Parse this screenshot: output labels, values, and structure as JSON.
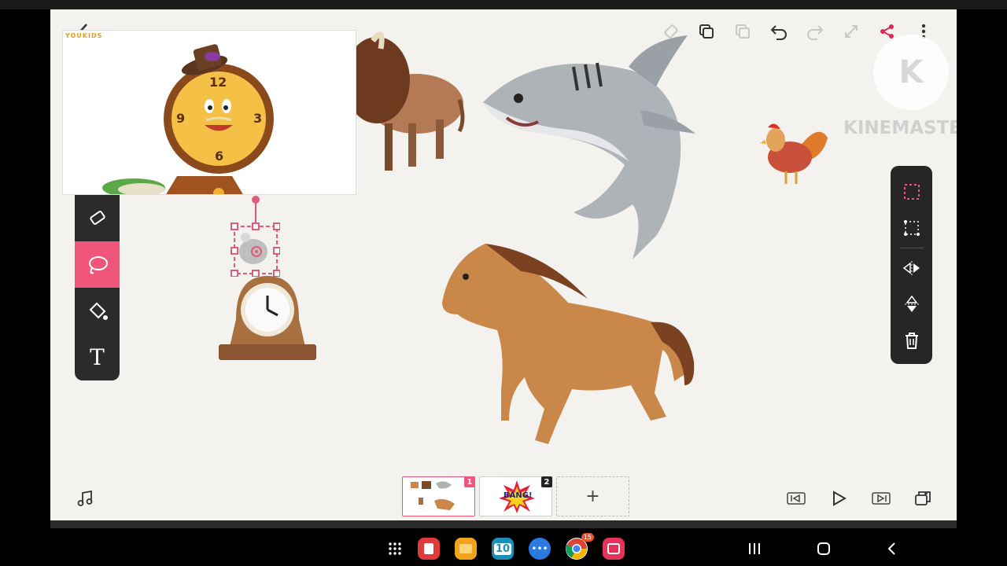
{
  "app": {
    "name": "drawing-canvas-app"
  },
  "top_bar": {
    "back_icon": "chevron-left-icon",
    "icons": [
      "tag-icon",
      "layers-icon",
      "copy-icon",
      "undo-icon",
      "redo-icon",
      "expand-icon",
      "share-icon",
      "more-vertical-icon"
    ]
  },
  "overlay_video": {
    "brand": "YOUKIDS",
    "clock_numbers": [
      "12",
      "3",
      "6",
      "9"
    ]
  },
  "watermark": {
    "text": "KINEMASTER",
    "letter": "K"
  },
  "left_toolbar": {
    "tools": [
      {
        "name": "eraser",
        "icon": "eraser-icon",
        "active": false
      },
      {
        "name": "lasso",
        "icon": "lasso-icon",
        "active": true
      },
      {
        "name": "fill",
        "icon": "fill-bucket-icon",
        "active": false
      },
      {
        "name": "text",
        "icon": "text-icon",
        "label": "T",
        "active": false
      }
    ]
  },
  "right_toolbar": {
    "tools": [
      "select-rect-icon",
      "crop-icon",
      "flip-horizontal-icon",
      "flip-vertical-icon",
      "trash-icon"
    ]
  },
  "stickers": [
    "bison",
    "shark",
    "rooster",
    "horse",
    "mouse",
    "mantel-clock"
  ],
  "pages": [
    {
      "number": "1",
      "selected": true,
      "thumb": "animals"
    },
    {
      "number": "2",
      "selected": false,
      "thumb_text": "BANG!"
    }
  ],
  "add_page_label": "+",
  "bottom_controls": [
    "music-icon",
    "skip-back-icon",
    "play-icon",
    "skip-forward-icon",
    "duplicate-icon"
  ],
  "taskbar": {
    "apps": [
      {
        "name": "apps-grid-icon",
        "color": "#000000"
      },
      {
        "name": "notes-app-icon",
        "color": "#e03a3a"
      },
      {
        "name": "files-app-icon",
        "color": "#f3a21b"
      },
      {
        "name": "calendar-app-icon",
        "color": "#1b8fb6",
        "label": "10"
      },
      {
        "name": "messages-app-icon",
        "color": "#2a7ae4"
      },
      {
        "name": "chrome-app-icon",
        "color": "#ffffff",
        "badge": "15"
      },
      {
        "name": "camera-app-icon",
        "color": "#e6335b"
      }
    ],
    "nav": [
      "recent-apps-icon",
      "home-icon",
      "back-icon"
    ]
  },
  "colors": {
    "accent": "#f0557c",
    "toolbar": "#2b2b2b",
    "canvas": "#f4f2ee"
  }
}
